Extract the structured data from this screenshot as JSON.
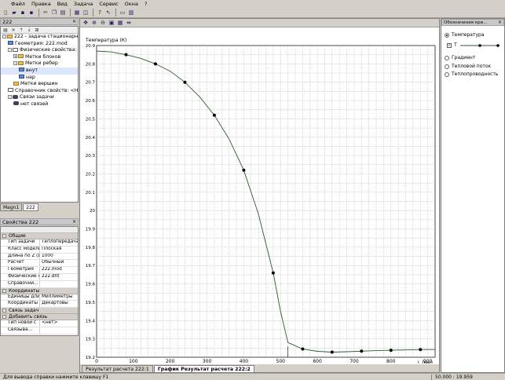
{
  "menu": [
    "Файл",
    "Правка",
    "Вид",
    "Задача",
    "Сервис",
    "Окна",
    "?"
  ],
  "left": {
    "tree_panel_title": "222",
    "tree": [
      {
        "label": "222 - задача стационарной т",
        "indent": 0,
        "icon": "fold",
        "pm": "-"
      },
      {
        "label": "Геометрия: 222.mod",
        "indent": 1,
        "icon": "blue",
        "pm": ""
      },
      {
        "label": "Физические свойства: 222.d",
        "indent": 1,
        "icon": "doc",
        "pm": "-"
      },
      {
        "label": "Метки блоков",
        "indent": 2,
        "icon": "fold",
        "pm": "+"
      },
      {
        "label": "Метки ребер",
        "indent": 2,
        "icon": "fold",
        "pm": "-"
      },
      {
        "label": "внут",
        "indent": 3,
        "icon": "blue",
        "pm": "",
        "selected": true
      },
      {
        "label": "нар",
        "indent": 3,
        "icon": "blue",
        "pm": ""
      },
      {
        "label": "Метки вершин",
        "indent": 2,
        "icon": "fold",
        "pm": ""
      },
      {
        "label": "Справочник свойств: <Не",
        "indent": 1,
        "icon": "doc",
        "pm": ""
      },
      {
        "label": "Связи задачи",
        "indent": 1,
        "icon": "link",
        "pm": "-"
      },
      {
        "label": "нет связей",
        "indent": 2,
        "icon": "link",
        "pm": ""
      }
    ],
    "tabs": [
      "Magn1",
      "222"
    ],
    "props_title": "Свойства 222",
    "props": [
      {
        "type": "cat",
        "label": "Общие"
      },
      {
        "type": "row",
        "key": "Тип задачи",
        "value": "Теплопередача..."
      },
      {
        "type": "row",
        "key": "Класс модели",
        "value": "Плоская"
      },
      {
        "type": "row",
        "key": "Длина по Z (L)",
        "value": "1000"
      },
      {
        "type": "row",
        "key": "Расчет",
        "value": "Обычный"
      },
      {
        "type": "row",
        "key": "Геометрия",
        "value": "222.mod"
      },
      {
        "type": "row",
        "key": "Физические св.",
        "value": "222.dht"
      },
      {
        "type": "row",
        "key": "Справочни...",
        "value": ""
      },
      {
        "type": "cat",
        "label": "Координаты"
      },
      {
        "type": "row",
        "key": "Единицы длин",
        "value": "Миллиметры"
      },
      {
        "type": "row",
        "key": "Координаты",
        "value": "Декартовы"
      },
      {
        "type": "cat",
        "label": "Связь задач"
      },
      {
        "type": "cat",
        "label": "Добавить связь"
      },
      {
        "type": "row",
        "key": "Тип новой с",
        "value": "<нет>"
      },
      {
        "type": "row",
        "key": "Связыва...",
        "value": ""
      }
    ]
  },
  "center": {
    "doc_tabs": [
      "Результат расчета 222:1",
      "График Результат расчета 222:2"
    ],
    "active_doc_tab": 1
  },
  "right": {
    "title": "Обозначения кри...",
    "options": [
      {
        "label": "Температура",
        "selected": true
      },
      {
        "label": "Градиент",
        "selected": false
      },
      {
        "label": "Тепловой поток",
        "selected": false
      },
      {
        "label": "Теплопроводность",
        "selected": false
      }
    ],
    "series_check_label": "T"
  },
  "status": {
    "hint": "Для вывода справки нажмите клавишу F1",
    "coords": "50.000 : 19.959"
  },
  "chart_data": {
    "type": "line",
    "ylabel": "Температура (К)",
    "xlabel": "L (мм)",
    "xlim": [
      0,
      920
    ],
    "ylim": [
      19.2,
      20.9
    ],
    "xticks": [
      0,
      100,
      200,
      300,
      400,
      500,
      600,
      700,
      800,
      900
    ],
    "xtick_labels": [
      "0",
      "100",
      "200",
      "300",
      "400",
      "500",
      "600",
      "700",
      "800",
      "900"
    ],
    "yticks": [
      19.2,
      19.3,
      19.4,
      19.5,
      19.6,
      19.7,
      19.8,
      19.9,
      20.0,
      20.1,
      20.2,
      20.3,
      20.4,
      20.5,
      20.6,
      20.7,
      20.8,
      20.9
    ],
    "ytick_labels": [
      "19.2",
      "19.3",
      "19.4",
      "19.5",
      "19.6",
      "19.7",
      "19.8",
      "19.9",
      "20",
      "20.1",
      "20.2",
      "20.3",
      "20.4",
      "20.5",
      "20.6",
      "20.7",
      "20.8",
      "20.9"
    ],
    "x": [
      0,
      40,
      80,
      120,
      160,
      200,
      240,
      280,
      320,
      360,
      400,
      440,
      480,
      500,
      520,
      560,
      600,
      640,
      680,
      720,
      760,
      800,
      840,
      880,
      920
    ],
    "y": [
      20.87,
      20.865,
      20.85,
      20.83,
      20.8,
      20.76,
      20.7,
      20.62,
      20.52,
      20.39,
      20.22,
      19.98,
      19.66,
      19.45,
      19.28,
      19.245,
      19.232,
      19.228,
      19.23,
      19.233,
      19.236,
      19.238,
      19.24,
      19.242,
      19.242
    ],
    "markers_x": [
      80,
      160,
      240,
      320,
      400,
      480,
      560,
      640,
      720,
      800,
      880
    ],
    "markers_y": [
      20.85,
      20.8,
      20.7,
      20.52,
      20.22,
      19.66,
      19.245,
      19.228,
      19.233,
      19.238,
      19.242
    ],
    "cursor_x": 520,
    "grid": true,
    "series_color": "#2e5a2e"
  }
}
